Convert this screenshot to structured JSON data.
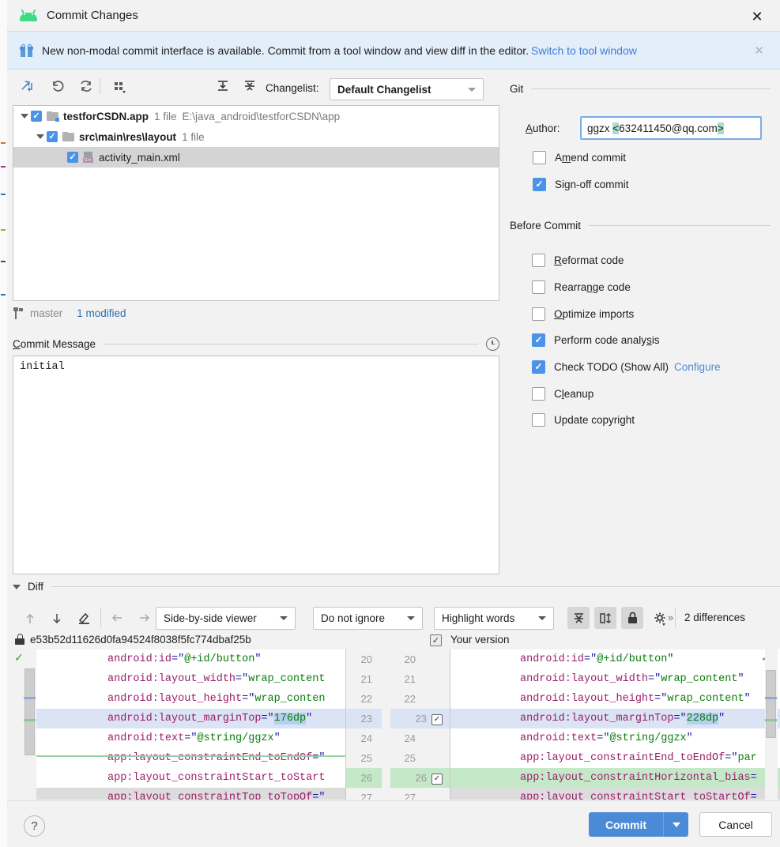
{
  "window": {
    "title": "Commit Changes",
    "app_icon": "android-icon",
    "close_icon": "close-icon"
  },
  "banner": {
    "icon": "gift-icon",
    "text": "New non-modal commit interface is available. Commit from a tool window and view diff in the editor.",
    "link": "Switch to tool window",
    "close_icon": "close-icon"
  },
  "toolbar": {
    "icons": [
      "include-into-commit-icon",
      "revert-icon",
      "refresh-icon",
      "group-by-icon"
    ],
    "expand_all_icon": "expand-all-icon",
    "collapse_all_icon": "collapse-all-icon",
    "changelist_label": "Changelist:",
    "changelist_value": "Default Changelist"
  },
  "file_tree": {
    "rows": [
      {
        "name": "testforCSDN.app",
        "meta": "1 file",
        "path": "E:\\java_android\\testforCSDN\\app",
        "checked": true,
        "expanded": true,
        "icon": "module-folder-icon",
        "indent": 0,
        "selected": false
      },
      {
        "name": "src\\main\\res\\layout",
        "meta": "1 file",
        "path": "",
        "checked": true,
        "expanded": true,
        "icon": "folder-icon",
        "indent": 1,
        "selected": false
      },
      {
        "name": "activity_main.xml",
        "meta": "",
        "path": "",
        "checked": true,
        "expanded": null,
        "icon": "xml-file-icon",
        "indent": 2,
        "selected": true
      }
    ]
  },
  "branch_status": {
    "icon": "branch-icon",
    "branch": "master",
    "modified": "1 modified"
  },
  "commit_message": {
    "label": "Commit Message",
    "history_icon": "clock-icon",
    "value": "initial"
  },
  "git_panel": {
    "section_title": "Git",
    "author_label": "Author:",
    "author_value_prefix": "ggzx ",
    "author_value_open": "<",
    "author_value_email": "632411450@qq.com",
    "author_value_close": ">",
    "checkboxes": [
      {
        "label": "Amend commit",
        "checked": false
      },
      {
        "label": "Sign-off commit",
        "checked": true
      }
    ]
  },
  "before_commit": {
    "section_title": "Before Commit",
    "checkboxes": [
      {
        "label": "Reformat code",
        "checked": false,
        "link": ""
      },
      {
        "label": "Rearrange code",
        "checked": false,
        "link": ""
      },
      {
        "label": "Optimize imports",
        "checked": false,
        "link": ""
      },
      {
        "label": "Perform code analysis",
        "checked": true,
        "link": ""
      },
      {
        "label": "Check TODO (Show All)",
        "checked": true,
        "link": "Configure"
      },
      {
        "label": "Cleanup",
        "checked": false,
        "link": ""
      },
      {
        "label": "Update copyright",
        "checked": false,
        "link": ""
      }
    ]
  },
  "diff": {
    "section_title": "Diff",
    "toolbar_icons": [
      "previous-difference-icon",
      "next-difference-icon",
      "edit-source-icon",
      "previous-change-icon",
      "next-change-icon"
    ],
    "viewer_mode": "Side-by-side viewer",
    "ignore_mode": "Do not ignore",
    "highlight_mode": "Highlight words",
    "collapse_unchanged_icon": "collapse-unchanged-icon",
    "align_changes_icon": "align-changes-icon",
    "readonly_lock_icon": "lock-icon",
    "settings_icon": "gear-icon",
    "more_icon": "chevron-double-right-icon",
    "differences_count": "2 differences",
    "left_version_icon": "lock-icon",
    "left_version_label": "e53b52d11626d0fa94524f8038f5fc774dbaf25b",
    "right_version_label": "Your version",
    "right_version_checked": true,
    "left_lines": [
      {
        "num": "20",
        "text": "android:id=\"@+id/button\"",
        "highlight": "",
        "chip": ""
      },
      {
        "num": "21",
        "text": "android:layout_width=\"wrap_content",
        "highlight": "",
        "chip": ""
      },
      {
        "num": "22",
        "text": "android:layout_height=\"wrap_conten",
        "highlight": "",
        "chip": ""
      },
      {
        "num": "23",
        "text": "android:layout_marginTop=\"176dp\"",
        "highlight": "blue",
        "chip": "176dp"
      },
      {
        "num": "24",
        "text": "android:text=\"@string/ggzx\"",
        "highlight": "",
        "chip": ""
      },
      {
        "num": "25",
        "text": "app:layout_constraintEnd_toEndOf=\"",
        "highlight": "",
        "chip": ""
      },
      {
        "num": "26",
        "text": "app:layout_constraintStart_toStart",
        "highlight": "",
        "chip": ""
      },
      {
        "num": "27",
        "text": "app:layout_constraintTop_toTopOf=\"",
        "highlight": "",
        "chip": ""
      }
    ],
    "right_lines": [
      {
        "num": "20",
        "text": "android:id=\"@+id/button\"",
        "highlight": "",
        "chip": "",
        "accept": false
      },
      {
        "num": "21",
        "text": "android:layout_width=\"wrap_content\"",
        "highlight": "",
        "chip": "",
        "accept": false
      },
      {
        "num": "22",
        "text": "android:layout_height=\"wrap_content\"",
        "highlight": "",
        "chip": "",
        "accept": false
      },
      {
        "num": "23",
        "text": "android:layout_marginTop=\"228dp\"",
        "highlight": "blue",
        "chip": "228dp",
        "accept": true
      },
      {
        "num": "24",
        "text": "android:text=\"@string/ggzx\"",
        "highlight": "",
        "chip": "",
        "accept": false
      },
      {
        "num": "25",
        "text": "app:layout_constraintEnd_toEndOf=\"par",
        "highlight": "",
        "chip": "",
        "accept": false
      },
      {
        "num": "26",
        "text": "app:layout_constraintHorizontal_bias=",
        "highlight": "green",
        "chip": "",
        "accept": true
      },
      {
        "num": "27",
        "text": "app:layout_constraintStart_toStartOf=",
        "highlight": "",
        "chip": "",
        "accept": false
      }
    ]
  },
  "footer": {
    "help_icon": "help-icon",
    "commit_label": "Commit",
    "commit_dropdown_icon": "chevron-down-icon",
    "cancel_label": "Cancel"
  },
  "colors": {
    "accent": "#4b8ad6",
    "banner_bg": "#e3eefb",
    "link": "#3b7dd8",
    "added_green": "#c4e8c8",
    "changed_blue": "#dbe4f5",
    "android_green": "#3ddc84"
  }
}
